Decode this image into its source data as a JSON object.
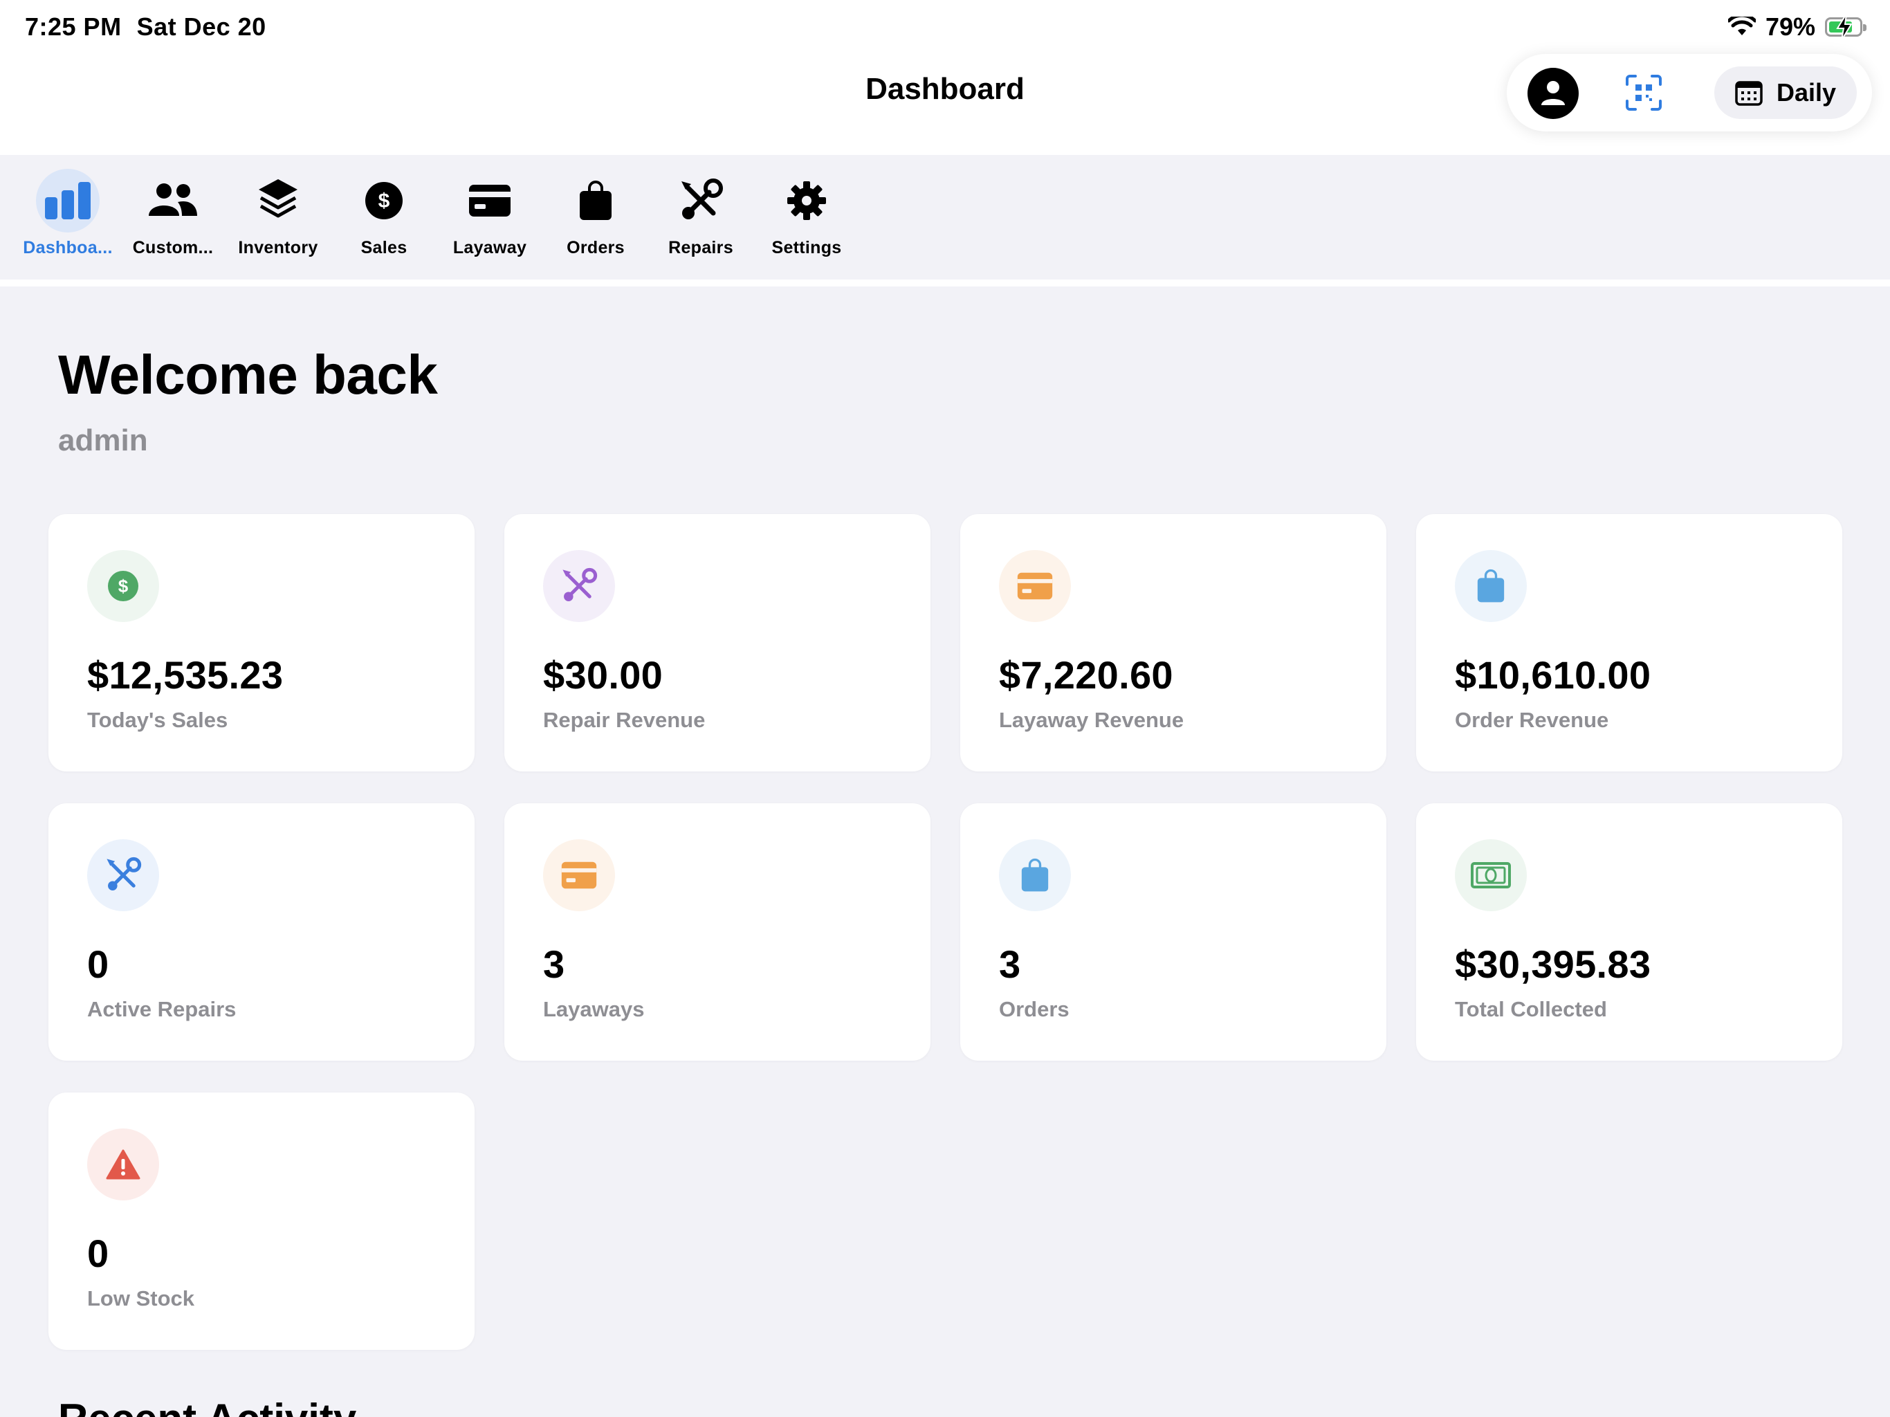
{
  "status_bar": {
    "time": "7:25 PM",
    "date": "Sat Dec 20",
    "battery": "79%",
    "battery_level": 0.79
  },
  "nav": {
    "title": "Dashboard",
    "daily_label": "Daily"
  },
  "tabs": [
    {
      "label": "Dashboa...",
      "icon": "bar-chart-icon",
      "active": true
    },
    {
      "label": "Custom...",
      "icon": "people-icon",
      "active": false
    },
    {
      "label": "Inventory",
      "icon": "layers-icon",
      "active": false
    },
    {
      "label": "Sales",
      "icon": "dollar-circle-icon",
      "active": false
    },
    {
      "label": "Layaway",
      "icon": "credit-card-icon",
      "active": false
    },
    {
      "label": "Orders",
      "icon": "shopping-bag-icon",
      "active": false
    },
    {
      "label": "Repairs",
      "icon": "wrench-screwdriver-icon",
      "active": false
    },
    {
      "label": "Settings",
      "icon": "gear-icon",
      "active": false
    }
  ],
  "welcome": {
    "title": "Welcome back",
    "user": "admin"
  },
  "cards": [
    {
      "value": "$12,535.23",
      "label": "Today's Sales",
      "icon": "dollar-icon",
      "color": "#4fa866",
      "bg": "#eef6f0"
    },
    {
      "value": "$30.00",
      "label": "Repair Revenue",
      "icon": "tools-icon",
      "color": "#9a5fd0",
      "bg": "#f3eef9"
    },
    {
      "value": "$7,220.60",
      "label": "Layaway Revenue",
      "icon": "credit-card-icon",
      "color": "#f0a04a",
      "bg": "#fdf3ea"
    },
    {
      "value": "$10,610.00",
      "label": "Order Revenue",
      "icon": "bag-icon",
      "color": "#5aa6e0",
      "bg": "#edf4fb"
    },
    {
      "value": "0",
      "label": "Active Repairs",
      "icon": "tools-icon",
      "color": "#3a7fde",
      "bg": "#ebf2fc"
    },
    {
      "value": "3",
      "label": "Layaways",
      "icon": "credit-card-icon",
      "color": "#f0a04a",
      "bg": "#fdf3ea"
    },
    {
      "value": "3",
      "label": "Orders",
      "icon": "bag-icon",
      "color": "#5aa6e0",
      "bg": "#edf4fb"
    },
    {
      "value": "$30,395.83",
      "label": "Total Collected",
      "icon": "banknote-icon",
      "color": "#4fa866",
      "bg": "#eef6f0"
    },
    {
      "value": "0",
      "label": "Low Stock",
      "icon": "warning-icon",
      "color": "#e2594a",
      "bg": "#fcecea"
    }
  ],
  "recent_activity_title": "Recent Activity"
}
